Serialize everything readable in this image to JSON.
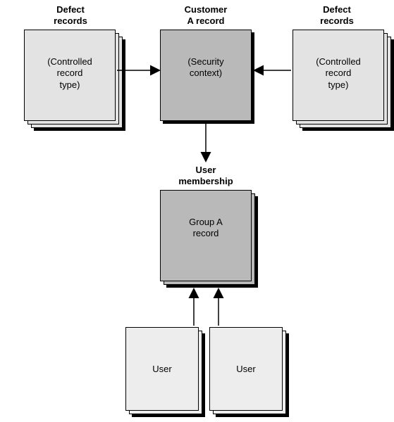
{
  "headings": {
    "defect_left": "Defect\nrecords",
    "customer": "Customer\nA record",
    "defect_right": "Defect\nrecords",
    "user_membership": "User\nmembership"
  },
  "boxes": {
    "defect_left": "(Controlled\nrecord\ntype)",
    "customer": "(Security\ncontext)",
    "defect_right": "(Controlled\nrecord\ntype)",
    "group": "Group A\nrecord",
    "user_left": "User",
    "user_right": "User"
  }
}
